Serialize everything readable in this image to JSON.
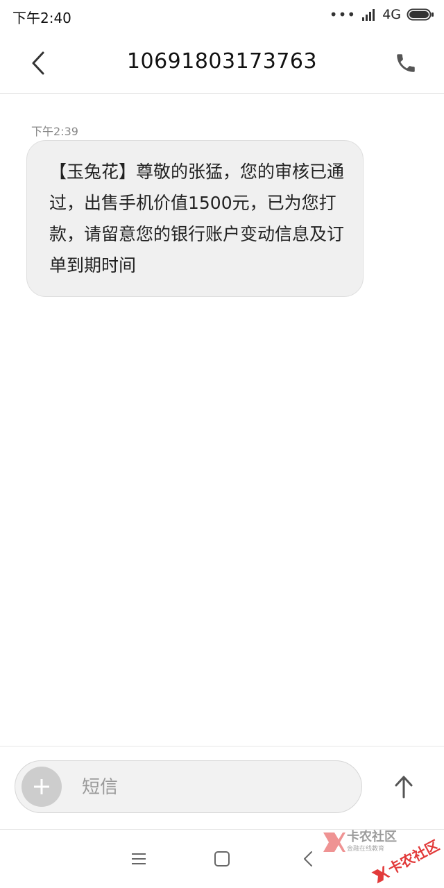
{
  "status_bar": {
    "time": "下午2:40",
    "dots": "•••",
    "network": "4G"
  },
  "header": {
    "title": "10691803173763",
    "back_icon": "chevron-left-icon",
    "call_icon": "phone-icon"
  },
  "conversation": {
    "messages": [
      {
        "time": "下午2:39",
        "text": "【玉兔花】尊敬的张猛，您的审核已通过，出售手机价值1500元，已为您打款，请留意您的银行账户变动信息及订单到期时间"
      }
    ]
  },
  "composer": {
    "placeholder": "短信",
    "value": "",
    "add_icon": "plus-icon",
    "send_icon": "arrow-up-icon"
  },
  "nav_bar": {
    "items": [
      "menu-icon",
      "home-square-icon",
      "back-chevron-icon"
    ]
  },
  "watermark": {
    "text": "卡农社区",
    "subtext": "金融在线教育",
    "stamp_text": "卡农社区",
    "color": "#e23a3a"
  },
  "colors": {
    "bubble_bg": "#f0f0f0",
    "icon_gray": "#555555",
    "watermark_red": "#e23a3a"
  }
}
